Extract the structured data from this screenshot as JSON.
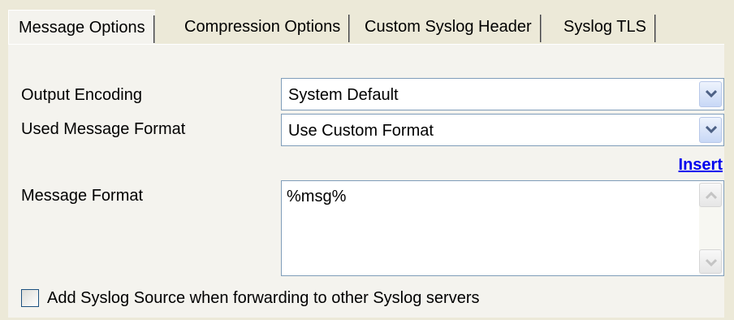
{
  "tabs": [
    {
      "label": "Message Options",
      "active": true
    },
    {
      "label": "Compression Options",
      "active": false
    },
    {
      "label": "Custom Syslog Header",
      "active": false
    },
    {
      "label": "Syslog TLS",
      "active": false
    }
  ],
  "output_encoding": {
    "label": "Output Encoding",
    "value": "System Default"
  },
  "message_format_mode": {
    "label": "Used Message Format",
    "value": "Use Custom Format"
  },
  "insert_link": "Insert",
  "message_format": {
    "label": "Message Format",
    "value": "%msg%"
  },
  "add_source_checkbox": {
    "label": "Add Syslog Source when forwarding to other Syslog servers",
    "checked": false
  },
  "colors": {
    "link": "#0000ee",
    "field_border": "#7f9db9",
    "dialog_bg": "#ece9d8"
  },
  "icons": {
    "dropdown": "chevron-down-icon",
    "scroll_up": "arrow-up-icon",
    "scroll_down": "arrow-down-icon"
  }
}
